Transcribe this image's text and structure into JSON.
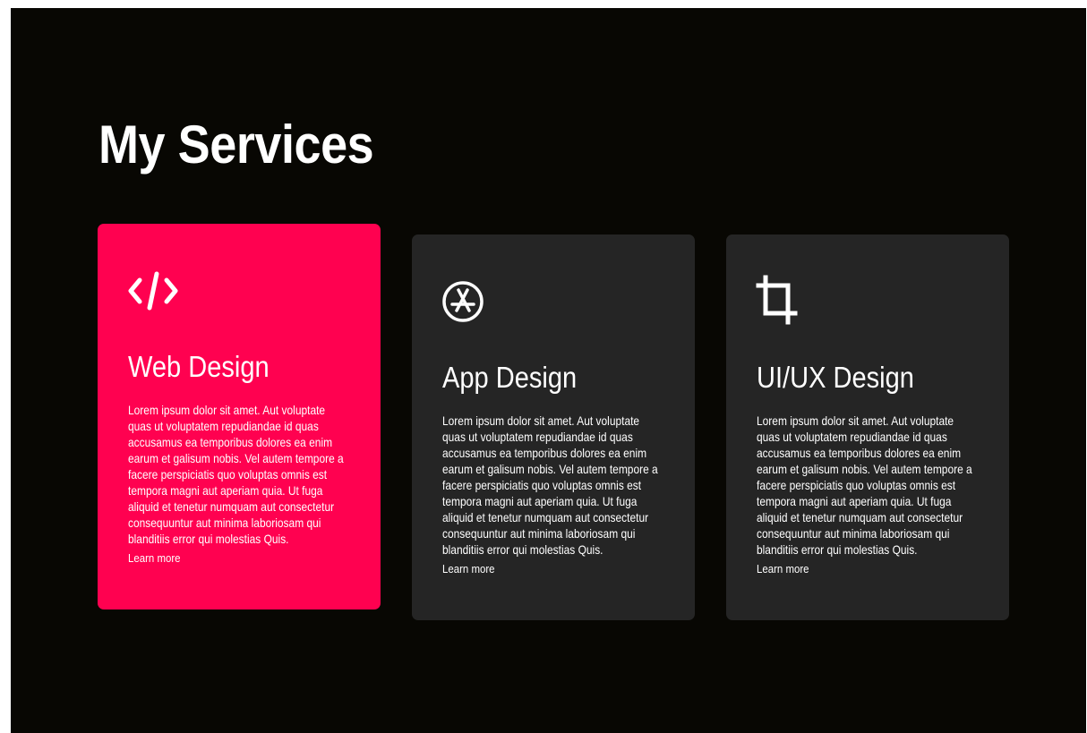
{
  "section": {
    "title": "My Services"
  },
  "colors": {
    "background": "#080703",
    "card": "#252525",
    "active_card": "#ff0150",
    "text": "#ffffff"
  },
  "cards": [
    {
      "icon": "code-icon",
      "title": "Web Design",
      "text": "Lorem ipsum dolor sit amet. Aut voluptate quas ut voluptatem repudiandae id quas accusamus ea temporibus dolores ea enim earum et galisum nobis. Vel autem tempore a facere perspiciatis quo voluptas omnis est tempora magni aut aperiam quia. Ut fuga aliquid et tenetur numquam aut consectetur consequuntur aut minima laboriosam qui blanditiis error qui molestias Quis.",
      "link": "Learn more",
      "active": true
    },
    {
      "icon": "app-store-icon",
      "title": "App Design",
      "text": "Lorem ipsum dolor sit amet. Aut voluptate quas ut voluptatem repudiandae id quas accusamus ea temporibus dolores ea enim earum et galisum nobis. Vel autem tempore a facere perspiciatis quo voluptas omnis est tempora magni aut aperiam quia. Ut fuga aliquid et tenetur numquam aut consectetur consequuntur aut minima laboriosam qui blanditiis error qui molestias Quis.",
      "link": "Learn more",
      "active": false
    },
    {
      "icon": "crop-icon",
      "title": "UI/UX Design",
      "text": "Lorem ipsum dolor sit amet. Aut voluptate quas ut voluptatem repudiandae id quas accusamus ea temporibus dolores ea enim earum et galisum nobis. Vel autem tempore a facere perspiciatis quo voluptas omnis est tempora magni aut aperiam quia. Ut fuga aliquid et tenetur numquam aut consectetur consequuntur aut minima laboriosam qui blanditiis error qui molestias Quis.",
      "link": "Learn more",
      "active": false
    }
  ]
}
